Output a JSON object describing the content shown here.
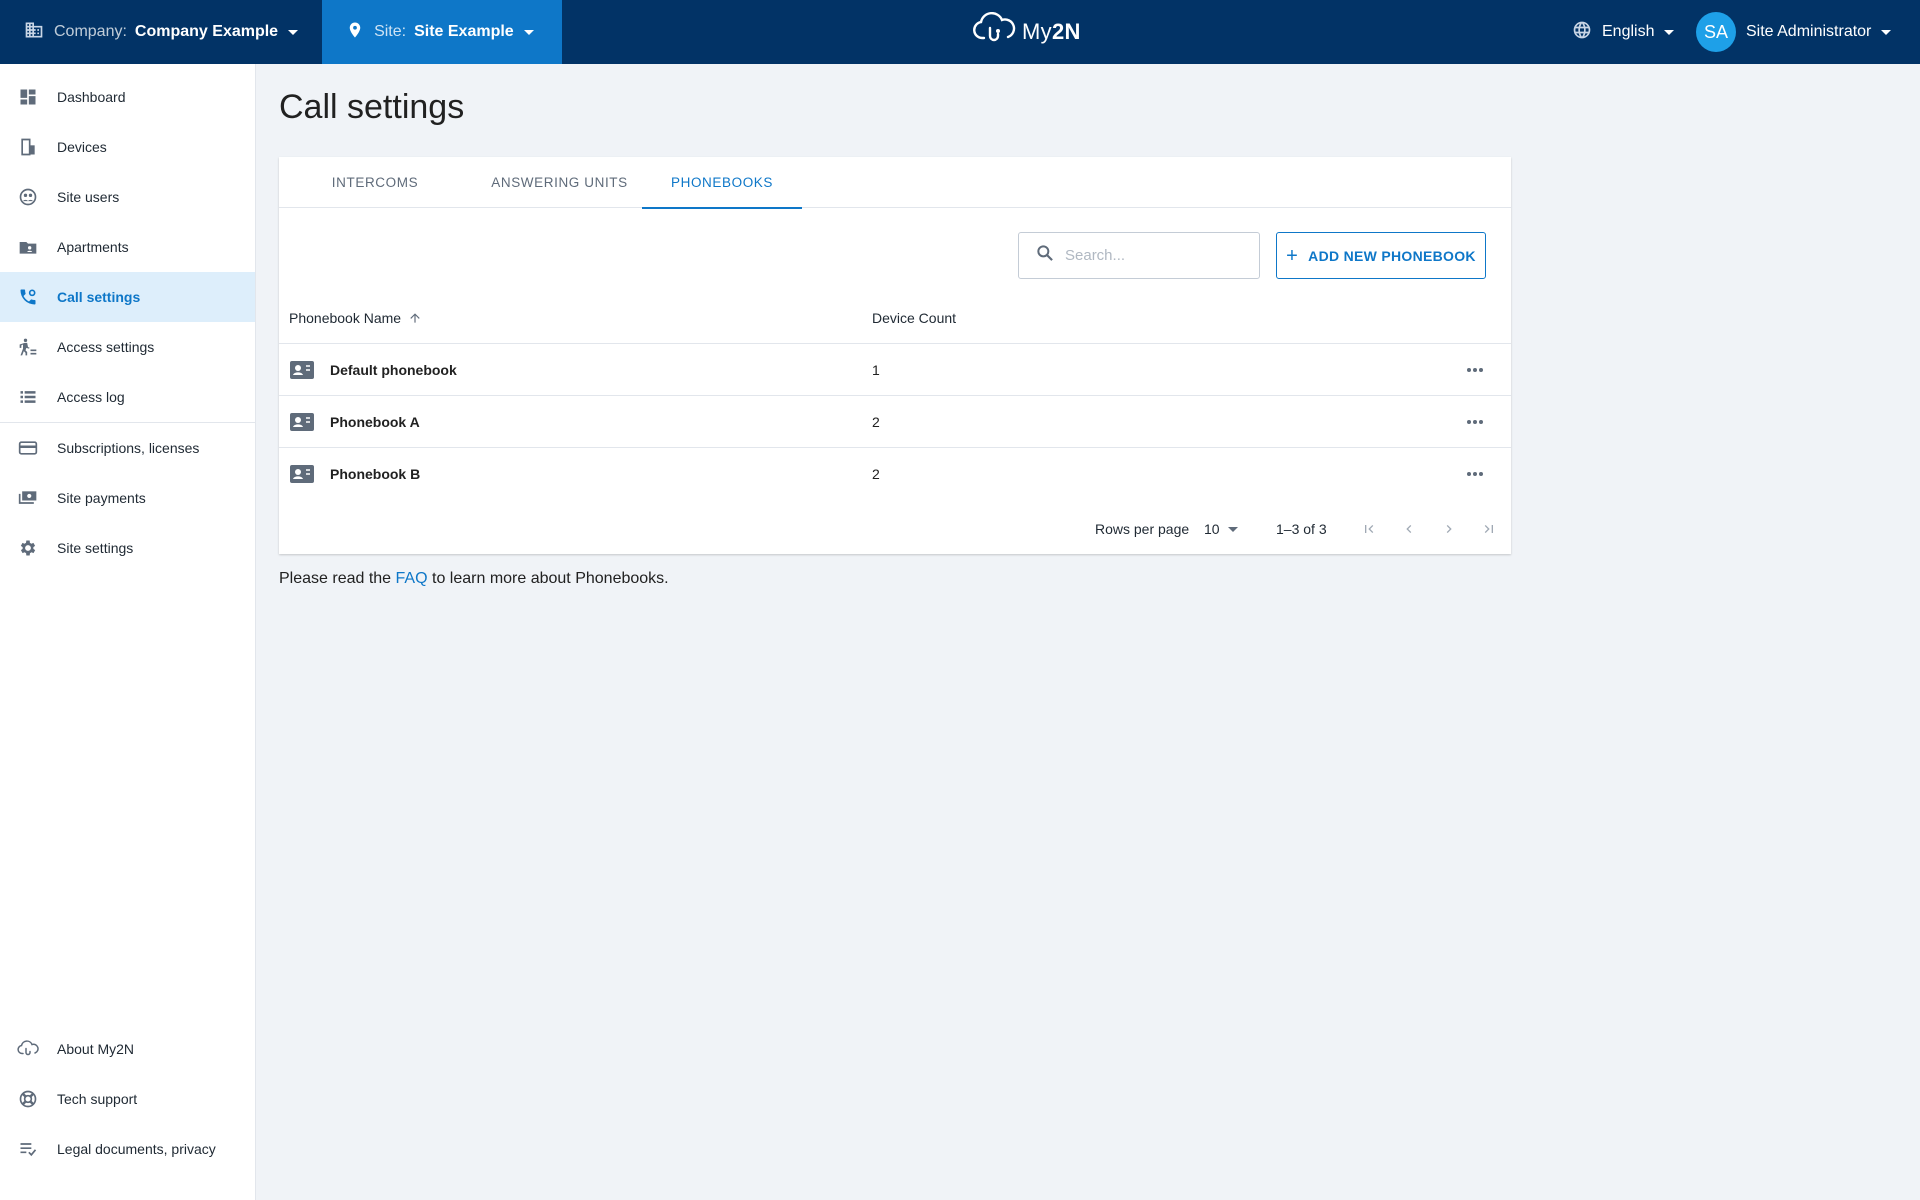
{
  "topbar": {
    "company_label": "Company:",
    "company_value": "Company Example",
    "site_label": "Site:",
    "site_value": "Site Example",
    "logo_text_a": "My",
    "logo_text_b": "2N",
    "language": "English",
    "user_initials": "SA",
    "user_name": "Site Administrator",
    "colors": {
      "bar": "#023366",
      "site": "#0e77c8",
      "avatar": "#1ea0e8"
    }
  },
  "sidebar": {
    "items": [
      {
        "label": "Dashboard",
        "icon": "dashboard-icon"
      },
      {
        "label": "Devices",
        "icon": "devices-icon"
      },
      {
        "label": "Site users",
        "icon": "site-users-icon"
      },
      {
        "label": "Apartments",
        "icon": "apartments-icon"
      },
      {
        "label": "Call settings",
        "icon": "call-settings-icon",
        "active": true
      },
      {
        "label": "Access settings",
        "icon": "access-settings-icon"
      },
      {
        "label": "Access log",
        "icon": "access-log-icon"
      },
      {
        "label": "Subscriptions, licenses",
        "icon": "credit-card-icon"
      },
      {
        "label": "Site payments",
        "icon": "payments-icon"
      },
      {
        "label": "Site settings",
        "icon": "gear-icon"
      }
    ],
    "footer_items": [
      {
        "label": "About My2N",
        "icon": "cloud-icon"
      },
      {
        "label": "Tech support",
        "icon": "lifebuoy-icon"
      },
      {
        "label": "Legal documents, privacy",
        "icon": "checklist-icon"
      }
    ]
  },
  "main": {
    "title": "Call settings",
    "tabs": [
      {
        "label": "INTERCOMS"
      },
      {
        "label": "ANSWERING UNITS"
      },
      {
        "label": "PHONEBOOKS",
        "active": true
      }
    ],
    "search_placeholder": "Search...",
    "add_button_label": "ADD NEW PHONEBOOK",
    "table": {
      "columns": [
        "Phonebook Name",
        "Device Count"
      ],
      "sort": "ascending",
      "rows": [
        {
          "name": "Default phonebook",
          "count": "1"
        },
        {
          "name": "Phonebook A",
          "count": "2"
        },
        {
          "name": "Phonebook B",
          "count": "2"
        }
      ]
    },
    "pagination": {
      "rows_per_page_label": "Rows per page",
      "rows_per_page_value": "10",
      "range": "1–3 of 3"
    },
    "faq": {
      "before": "Please read the",
      "link": "FAQ",
      "after": "to learn more about Phonebooks."
    }
  }
}
